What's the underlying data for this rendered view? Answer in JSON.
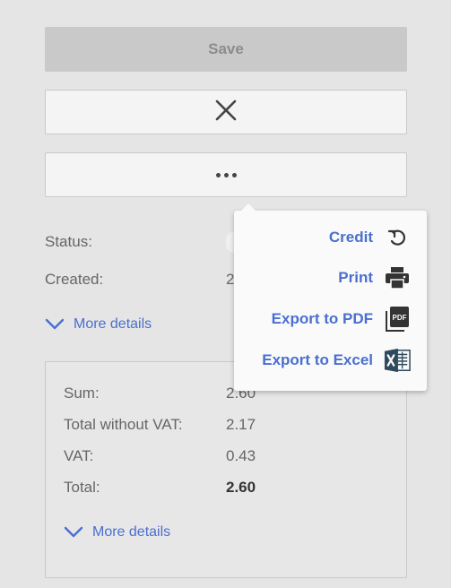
{
  "buttons": {
    "save_label": "Save"
  },
  "fields": {
    "status_label": "Status:",
    "created_label": "Created:",
    "created_value": "2"
  },
  "more_details_top": "More details",
  "summary": {
    "rows": [
      {
        "label": "Sum:",
        "value": "2.60"
      },
      {
        "label": "Total without VAT:",
        "value": "2.17"
      },
      {
        "label": "VAT:",
        "value": "0.43"
      },
      {
        "label": "Total:",
        "value": "2.60"
      }
    ],
    "more_details": "More details"
  },
  "menu": {
    "items": [
      {
        "label": "Credit",
        "icon": "undo-icon"
      },
      {
        "label": "Print",
        "icon": "printer-icon"
      },
      {
        "label": "Export to PDF",
        "icon": "pdf-file-icon"
      },
      {
        "label": "Export to Excel",
        "icon": "excel-file-icon"
      }
    ]
  },
  "colors": {
    "accent": "#4a6fd0",
    "background": "#e5e5e5",
    "save_disabled": "#c9c9c9",
    "excel_dark": "#2f4a5c"
  }
}
